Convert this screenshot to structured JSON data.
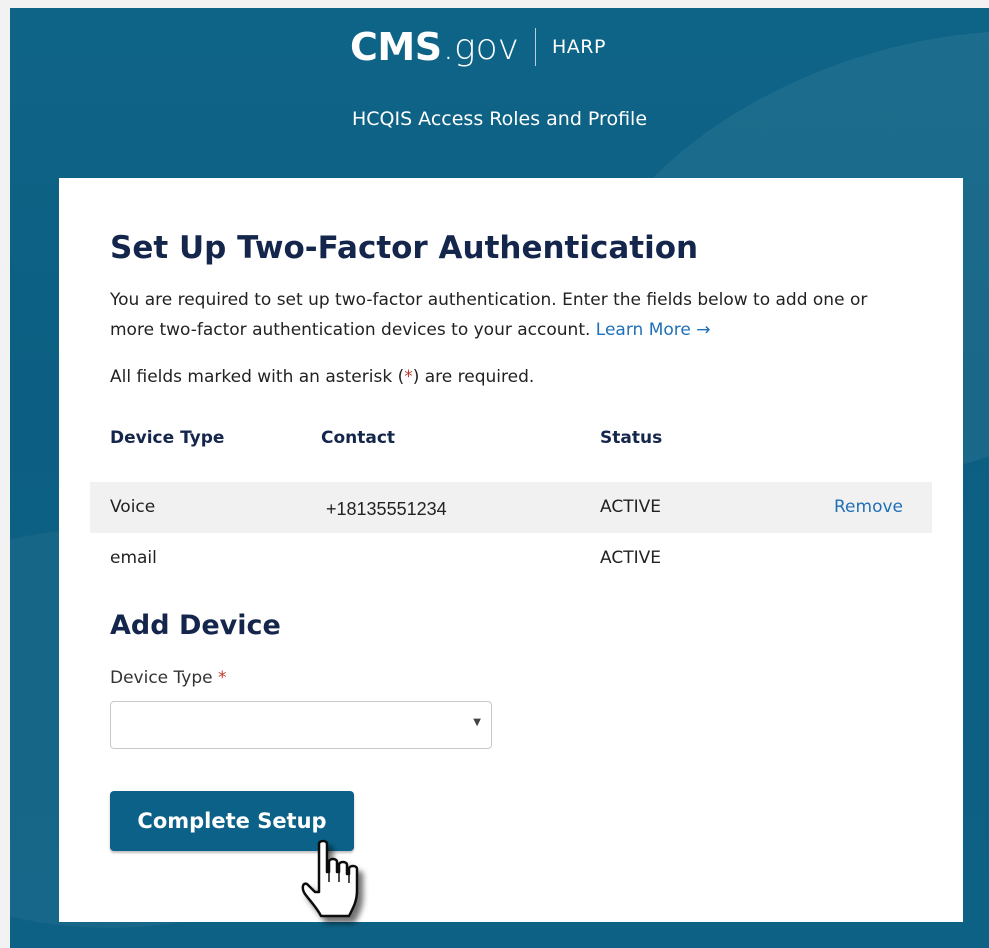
{
  "header": {
    "brand_cms": "CMS",
    "brand_gov": ".gov",
    "brand_harp": "HARP",
    "subtitle": "HCQIS Access Roles and Profile"
  },
  "page": {
    "title": "Set Up Two-Factor Authentication",
    "intro_text": "You are required to set up two-factor authentication. Enter the fields below to add one or more two-factor authentication devices to your account.",
    "learn_more_label": "Learn More",
    "learn_more_arrow": "→",
    "required_note_prefix": "All fields marked with an asterisk (",
    "required_note_asterisk": "*",
    "required_note_suffix": ") are required."
  },
  "devices_table": {
    "headers": {
      "device_type": "Device Type",
      "contact": "Contact",
      "status": "Status"
    },
    "rows": [
      {
        "device_type": "Voice",
        "contact": "+18135551234",
        "status": "ACTIVE",
        "action": "Remove"
      },
      {
        "device_type": "email",
        "contact": "",
        "status": "ACTIVE",
        "action": ""
      }
    ]
  },
  "add_device": {
    "title": "Add Device",
    "device_type_label": "Device Type",
    "required_marker": "*",
    "device_type_selected": ""
  },
  "actions": {
    "complete_setup_label": "Complete Setup"
  },
  "colors": {
    "header_bg": "#0e6487",
    "heading_text": "#14264b",
    "link": "#1f70b8",
    "button_bg": "#0b6187",
    "required": "#c0392b"
  },
  "icons": {
    "cursor": "hand-pointer-icon",
    "select_arrow": "caret-down-icon"
  }
}
